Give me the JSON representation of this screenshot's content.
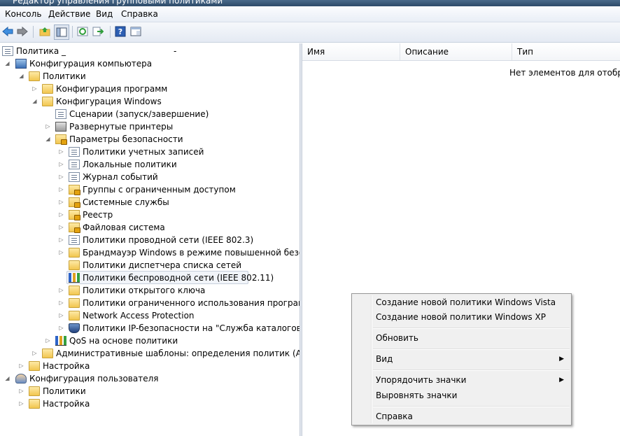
{
  "window": {
    "title": "Редактор управления групповыми политиками"
  },
  "menubar": {
    "items": [
      "Консоль",
      "Действие",
      "Вид",
      "Справка"
    ]
  },
  "toolbar": {
    "buttons": [
      "back-icon",
      "forward-icon",
      "up-folder-icon",
      "show-hide-tree-icon",
      "refresh-icon",
      "export-icon",
      "help-icon",
      "properties-icon"
    ]
  },
  "tree": {
    "items": [
      {
        "label": "Политика _",
        "icon": "policy-doc-icon"
      },
      {
        "label": "Конфигурация компьютера",
        "icon": "computer-icon"
      },
      {
        "label": "Политики",
        "icon": "folder-icon"
      },
      {
        "label": "Конфигурация программ",
        "icon": "folder-icon"
      },
      {
        "label": "Конфигурация Windows",
        "icon": "folder-icon"
      },
      {
        "label": "Сценарии (запуск/завершение)",
        "icon": "script-doc-icon"
      },
      {
        "label": "Развернутые принтеры",
        "icon": "printer-icon"
      },
      {
        "label": "Параметры безопасности",
        "icon": "security-icon"
      },
      {
        "label": "Политики учетных записей",
        "icon": "policy-doc-icon"
      },
      {
        "label": "Локальные политики",
        "icon": "policy-doc-icon"
      },
      {
        "label": "Журнал событий",
        "icon": "policy-doc-icon"
      },
      {
        "label": "Группы с ограниченным доступом",
        "icon": "locked-folder-icon"
      },
      {
        "label": "Системные службы",
        "icon": "locked-folder-icon"
      },
      {
        "label": "Реестр",
        "icon": "locked-folder-icon"
      },
      {
        "label": "Файловая система",
        "icon": "locked-folder-icon"
      },
      {
        "label": "Политики проводной сети (IEEE 802.3)",
        "icon": "policy-doc-icon"
      },
      {
        "label": "Брандмауэр Windows в режиме повышенной безопасно",
        "icon": "folder-icon"
      },
      {
        "label": "Политики диспетчера списка сетей",
        "icon": "folder-icon"
      },
      {
        "label": "Политики беспроводной сети (IEEE 802.11)",
        "icon": "wireless-chart-icon"
      },
      {
        "label": "Политики открытого ключа",
        "icon": "folder-icon"
      },
      {
        "label": "Политики ограниченного использования программ",
        "icon": "folder-icon"
      },
      {
        "label": "Network Access Protection",
        "icon": "folder-icon"
      },
      {
        "label": "Политики IP-безопасности на \"Служба каталогов Active",
        "icon": "shield-icon"
      },
      {
        "label": "QoS на основе политики",
        "icon": "qos-chart-icon"
      },
      {
        "label": "Административные шаблоны: определения политик (ADMX-ф",
        "icon": "folder-icon"
      },
      {
        "label": "Настройка",
        "icon": "folder-icon"
      },
      {
        "label": "Конфигурация пользователя",
        "icon": "user-icon"
      },
      {
        "label": "Политики",
        "icon": "folder-icon"
      },
      {
        "label": "Настройка",
        "icon": "folder-icon"
      }
    ]
  },
  "list": {
    "columns": [
      "Имя",
      "Описание",
      "Тип"
    ],
    "empty_message": "Нет элементов для отображе"
  },
  "context_menu": {
    "items": [
      {
        "label": "Создание новой политики Windows Vista"
      },
      {
        "label": "Создание новой политики Windows XP"
      },
      {
        "label": "Обновить"
      },
      {
        "label": "Вид",
        "submenu": true
      },
      {
        "label": "Упорядочить значки",
        "submenu": true
      },
      {
        "label": "Выровнять значки"
      },
      {
        "label": "Справка"
      }
    ]
  }
}
